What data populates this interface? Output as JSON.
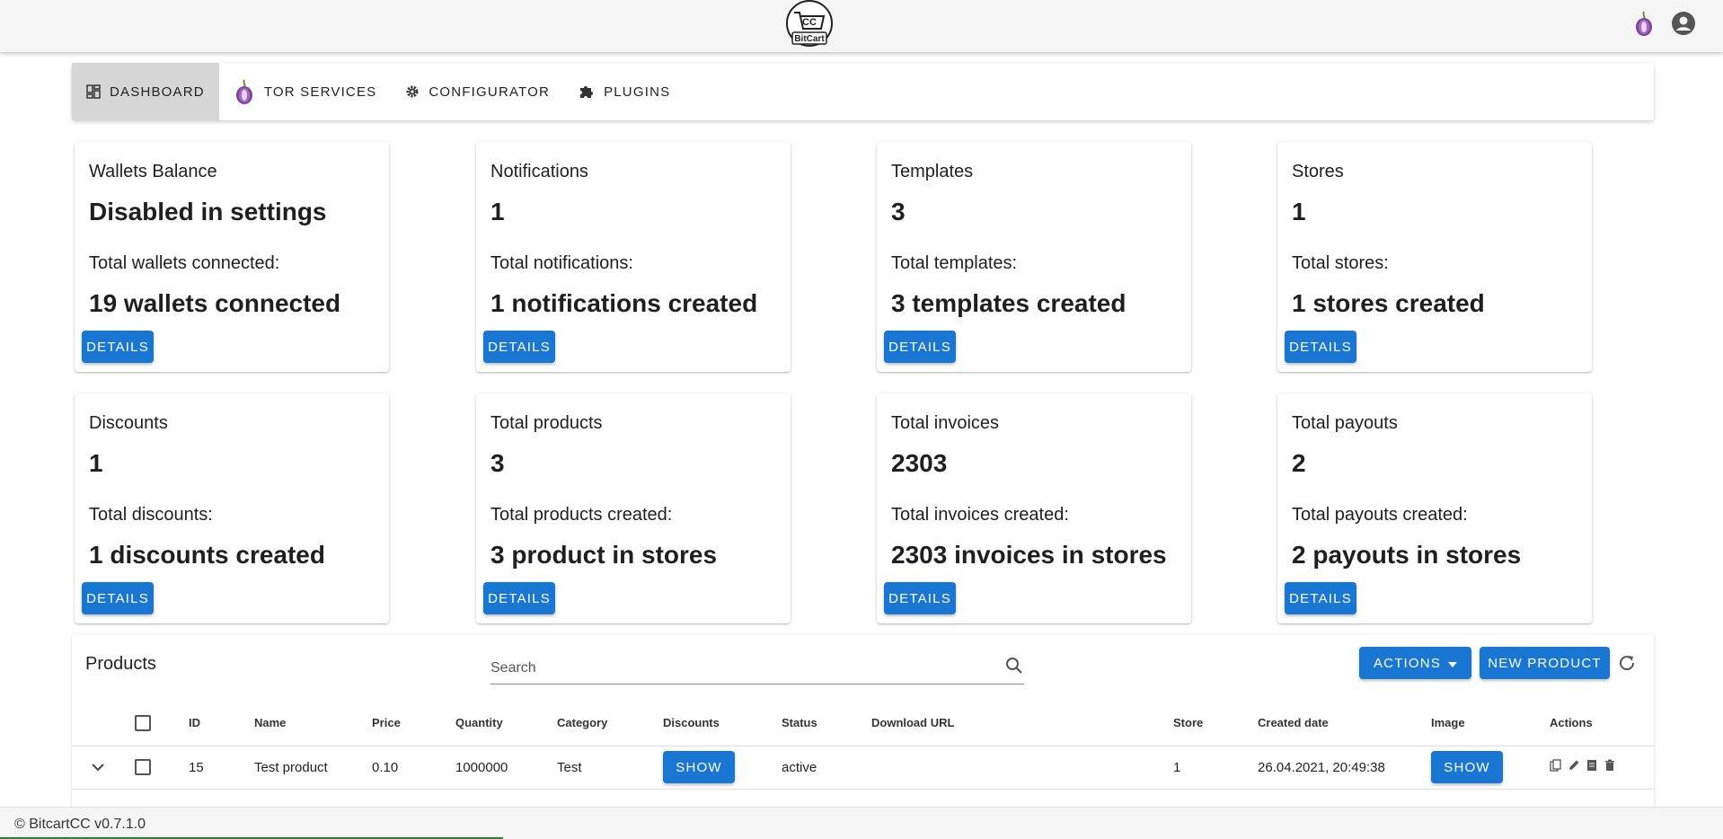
{
  "nav": {
    "tabs": [
      {
        "label": "Dashboard",
        "icon": "dashboard-icon"
      },
      {
        "label": "Tor Services",
        "icon": "tor-onion-icon"
      },
      {
        "label": "Configurator",
        "icon": "gear-icon"
      },
      {
        "label": "Plugins",
        "icon": "puzzle-icon"
      }
    ]
  },
  "cards": [
    {
      "title": "Wallets Balance",
      "value": "Disabled in settings",
      "sub": "Total wallets connected:",
      "subvalue": "19 wallets connected",
      "button": "Details"
    },
    {
      "title": "Notifications",
      "value": "1",
      "sub": "Total notifications:",
      "subvalue": "1 notifications created",
      "button": "Details"
    },
    {
      "title": "Templates",
      "value": "3",
      "sub": "Total templates:",
      "subvalue": "3 templates created",
      "button": "Details"
    },
    {
      "title": "Stores",
      "value": "1",
      "sub": "Total stores:",
      "subvalue": "1 stores created",
      "button": "Details"
    },
    {
      "title": "Discounts",
      "value": "1",
      "sub": "Total discounts:",
      "subvalue": "1 discounts created",
      "button": "Details"
    },
    {
      "title": "Total products",
      "value": "3",
      "sub": "Total products created:",
      "subvalue": "3 product in stores",
      "button": "Details"
    },
    {
      "title": "Total invoices",
      "value": "2303",
      "sub": "Total invoices created:",
      "subvalue": "2303 invoices in stores",
      "button": "Details"
    },
    {
      "title": "Total payouts",
      "value": "2",
      "sub": "Total payouts created:",
      "subvalue": "2 payouts in stores",
      "button": "Details"
    }
  ],
  "products": {
    "title": "Products",
    "search_placeholder": "Search",
    "actions_label": "Actions",
    "new_label": "New Product",
    "columns": [
      "ID",
      "Name",
      "Price",
      "Quantity",
      "Category",
      "Discounts",
      "Status",
      "Download URL",
      "Store",
      "Created date",
      "Image",
      "Actions"
    ],
    "rows": [
      {
        "id": "15",
        "name": "Test product",
        "price": "0.10",
        "quantity": "1000000",
        "category": "Test",
        "discounts": "Show",
        "status": "active",
        "download_url": "",
        "store": "1",
        "created": "26.04.2021, 20:49:38",
        "image": "Show"
      }
    ]
  },
  "footer": {
    "text": "© BitcartCC v0.7.1.0"
  },
  "colors": {
    "primary": "#1976d2",
    "appbar": "#f5f5f5",
    "active_tab": "#d6d6d6"
  }
}
